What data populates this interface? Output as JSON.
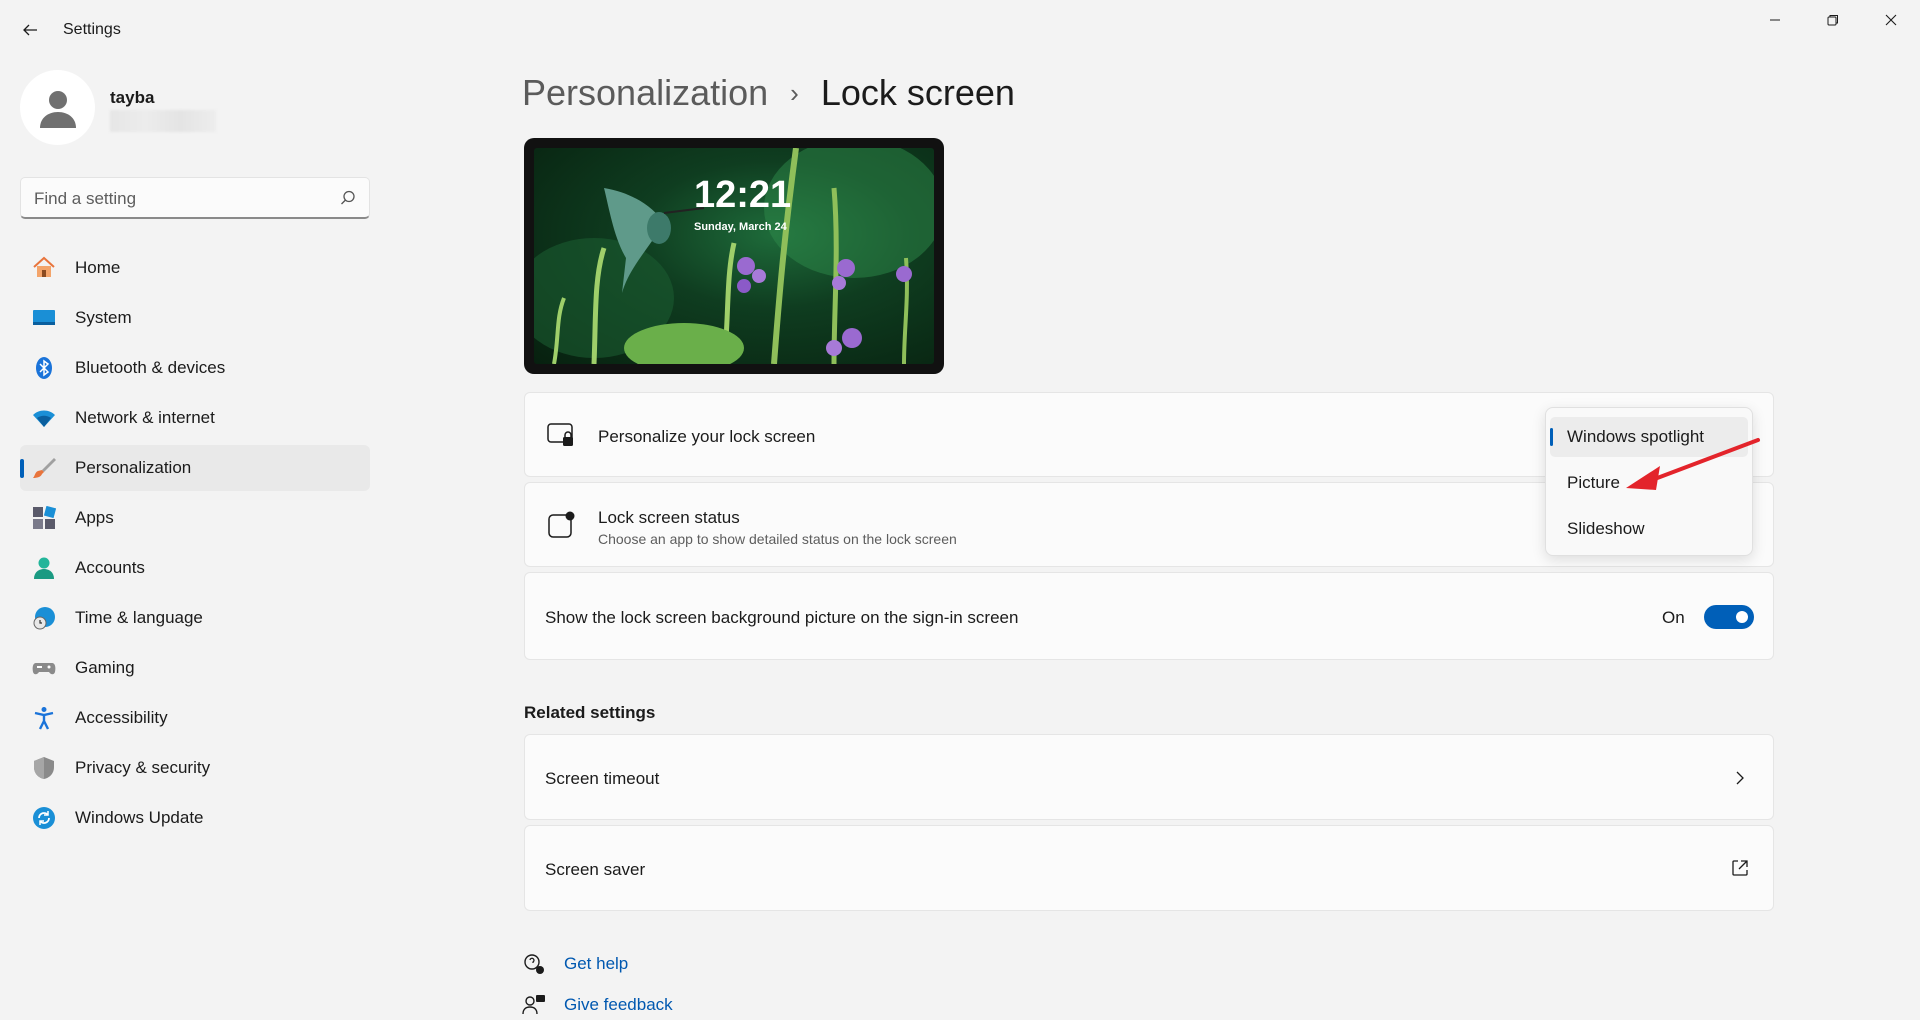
{
  "window": {
    "title": "Settings"
  },
  "profile": {
    "name": "tayba"
  },
  "search": {
    "placeholder": "Find a setting"
  },
  "nav": {
    "items": [
      {
        "label": "Home",
        "icon": "home-icon"
      },
      {
        "label": "System",
        "icon": "monitor-icon"
      },
      {
        "label": "Bluetooth & devices",
        "icon": "bluetooth-icon"
      },
      {
        "label": "Network & internet",
        "icon": "wifi-icon"
      },
      {
        "label": "Personalization",
        "icon": "paintbrush-icon",
        "selected": true
      },
      {
        "label": "Apps",
        "icon": "apps-icon"
      },
      {
        "label": "Accounts",
        "icon": "person-icon"
      },
      {
        "label": "Time & language",
        "icon": "globe-clock-icon"
      },
      {
        "label": "Gaming",
        "icon": "gamepad-icon"
      },
      {
        "label": "Accessibility",
        "icon": "accessibility-icon"
      },
      {
        "label": "Privacy & security",
        "icon": "shield-icon"
      },
      {
        "label": "Windows Update",
        "icon": "update-icon"
      }
    ]
  },
  "breadcrumb": {
    "parent": "Personalization",
    "separator": "›",
    "current": "Lock screen"
  },
  "preview": {
    "time": "12:21",
    "date": "Sunday, March 24"
  },
  "cards": {
    "personalize": {
      "title": "Personalize your lock screen"
    },
    "status": {
      "title": "Lock screen status",
      "subtitle": "Choose an app to show detailed status on the lock screen"
    },
    "signin": {
      "title": "Show the lock screen background picture on the sign-in screen",
      "state": "On"
    }
  },
  "dropdown": {
    "options": [
      "Windows spotlight",
      "Picture",
      "Slideshow"
    ],
    "selected": "Windows spotlight"
  },
  "related": {
    "title": "Related settings",
    "screen_timeout": "Screen timeout",
    "screen_saver": "Screen saver"
  },
  "help": {
    "get_help": "Get help",
    "give_feedback": "Give feedback"
  },
  "colors": {
    "accent": "#005fb8",
    "annotation": "#e3242b"
  }
}
